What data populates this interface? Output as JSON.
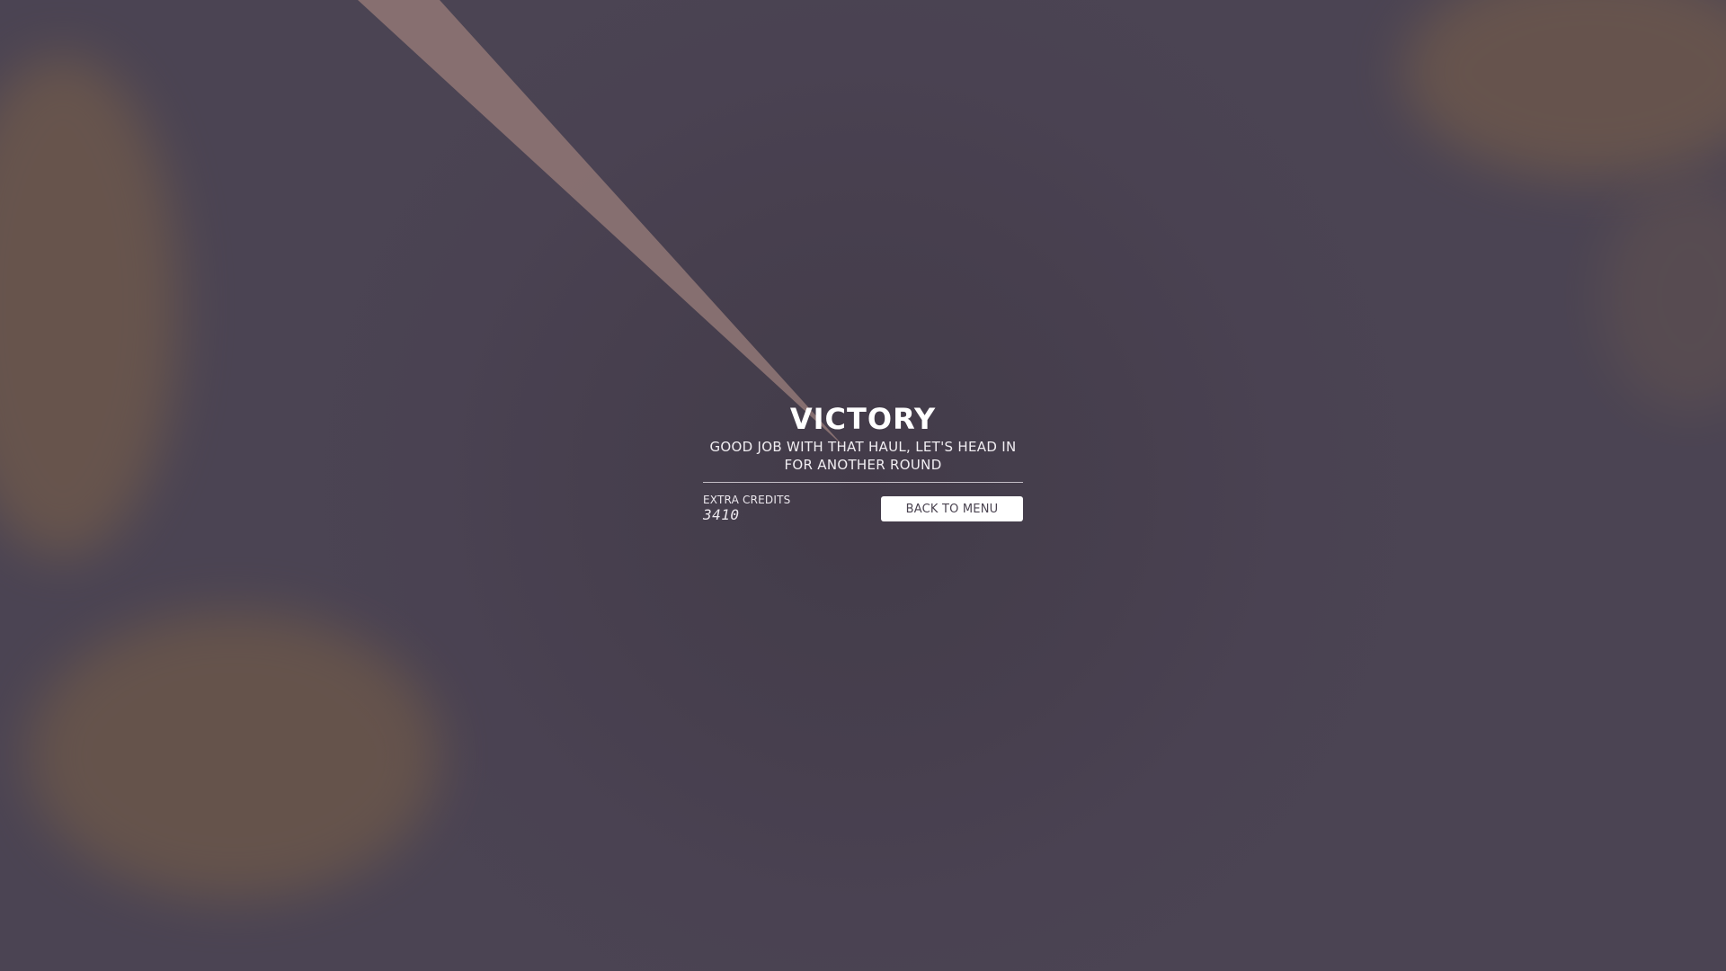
{
  "screen": {
    "title": "VICTORY",
    "subtitle": "GOOD JOB WITH THAT HAUL, LET'S HEAD IN FOR ANOTHER ROUND",
    "credits_label": "EXTRA CREDITS",
    "credits_value": "3410",
    "back_button_label": "BACK TO MENU"
  },
  "colors": {
    "background": "#4b4453",
    "beam": "#8a7272",
    "dust": "#8a6b4a",
    "text": "#ffffff",
    "button_bg": "#ffffff",
    "button_text": "#4a4350"
  }
}
